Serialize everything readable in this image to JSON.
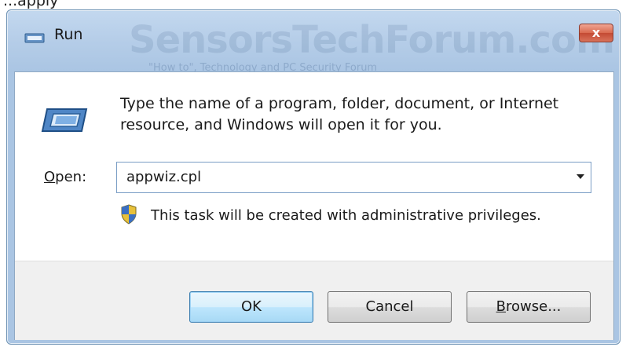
{
  "top_fragment": "...apply",
  "window": {
    "title": "Run",
    "watermark": "SensorsTechForum.com",
    "watermark_tagline": "\"How to\", Technology and PC Security Forum",
    "close_glyph": "x"
  },
  "dialog": {
    "description": "Type the name of a program, folder, document, or Internet resource, and Windows will open it for you.",
    "open_label_accel": "O",
    "open_label_rest": "pen:",
    "open_value": "appwiz.cpl",
    "admin_note": "This task will be created with administrative privileges."
  },
  "buttons": {
    "ok": "OK",
    "cancel": "Cancel",
    "browse_accel": "B",
    "browse_rest": "rowse..."
  },
  "icons": {
    "title": "run-icon",
    "dialog": "run-icon",
    "admin": "uac-shield-icon",
    "close": "close-icon",
    "dropdown": "chevron-down-icon"
  },
  "colors": {
    "titlebar": "#b5cde8",
    "close_button": "#d9694f",
    "ok_button_accent": "#3c7fb1",
    "button_area": "#f0f0f0"
  }
}
